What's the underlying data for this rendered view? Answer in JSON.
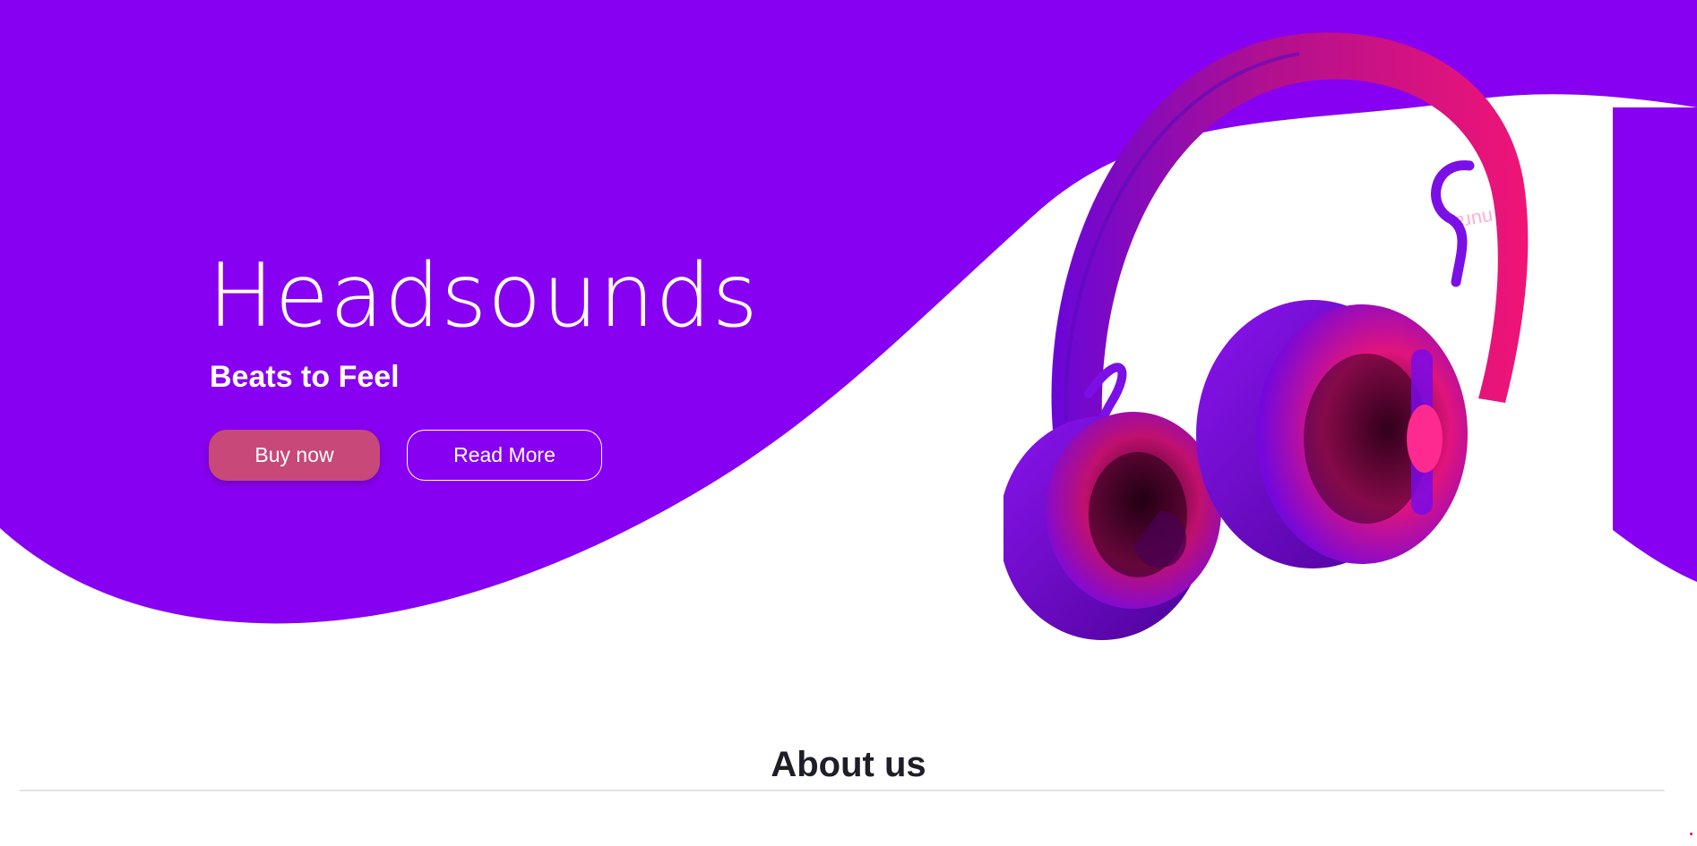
{
  "hero": {
    "title": "Headsounds",
    "subtitle": "Beats to Feel",
    "buy_button_label": "Buy now",
    "read_more_label": "Read More",
    "brand_mark": "nura"
  },
  "about": {
    "title": "About us"
  },
  "colors": {
    "hero_purple": "#8800f2",
    "buy_button": "#c8487a",
    "headphone_pink": "#e6157c",
    "headphone_purple": "#7a0ae6",
    "heading_dark": "#1e1e28"
  },
  "icons": {
    "product_image": "headphones-image"
  }
}
